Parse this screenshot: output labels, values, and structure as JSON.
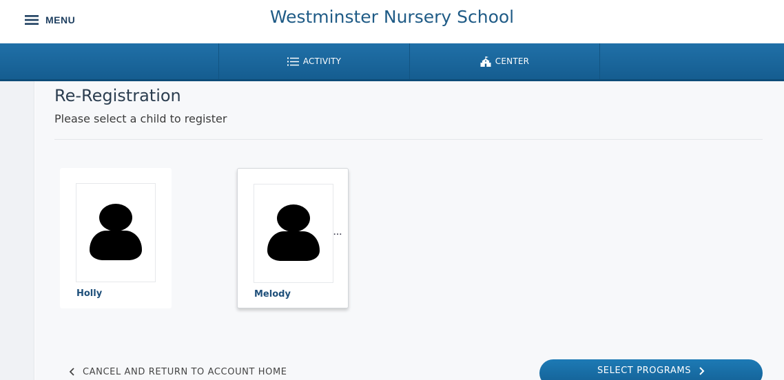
{
  "header": {
    "menu_label": "MENU",
    "school_name": "Westminster Nursery School"
  },
  "nav": {
    "items": [
      {
        "label": "ACTIVITY",
        "icon": "list-icon"
      },
      {
        "label": "CENTER",
        "icon": "school-building-icon"
      }
    ]
  },
  "page": {
    "title": "Re-Registration",
    "subtitle": "Please select a child to register"
  },
  "children": [
    {
      "name": "Holly",
      "selected": false,
      "avatar_icon": "person-silhouette-icon"
    },
    {
      "name": "Melody",
      "selected": true,
      "avatar_icon": "person-silhouette-icon",
      "more_indicator": "..."
    }
  ],
  "footer": {
    "cancel_label": "CANCEL AND RETURN TO ACCOUNT HOME",
    "select_label": "SELECT PROGRAMS"
  },
  "colors": {
    "brand_blue": "#1a67a0",
    "title_blue": "#1f5b86",
    "name_blue": "#1e4f7a",
    "background": "#f7f8fa"
  }
}
